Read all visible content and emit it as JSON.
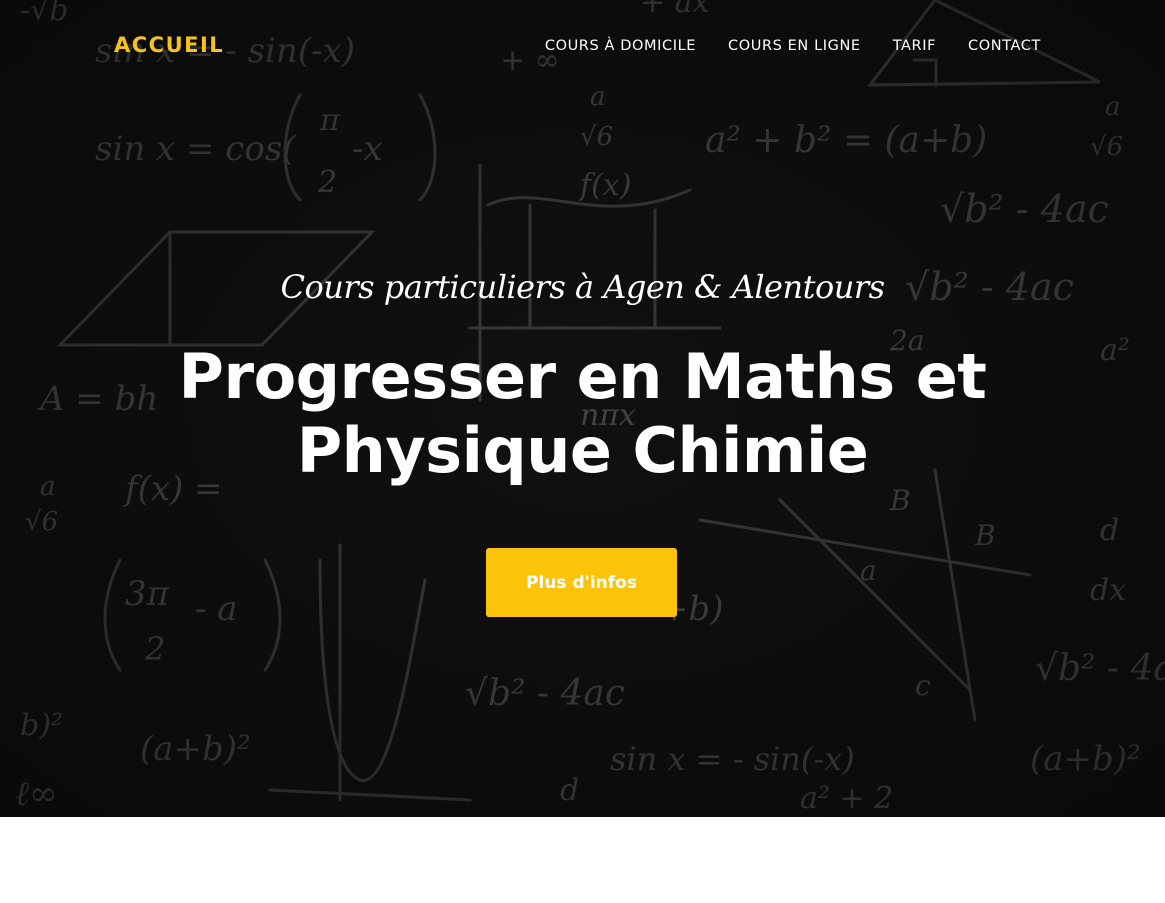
{
  "header": {
    "brand": "ACCUEIL",
    "nav": [
      {
        "label": "COURS À DOMICILE"
      },
      {
        "label": "COURS EN LIGNE"
      },
      {
        "label": "TARIF"
      },
      {
        "label": "CONTACT"
      }
    ]
  },
  "hero": {
    "subtitle": "Cours particuliers à Agen & Alentours",
    "title_line1": "Progresser en Maths et",
    "title_line2": "Physique Chimie",
    "cta_label": "Plus d'infos"
  },
  "colors": {
    "accent": "#fcc30b",
    "brand": "#f7c21b",
    "hero_background": "#161616",
    "text": "#ffffff"
  }
}
